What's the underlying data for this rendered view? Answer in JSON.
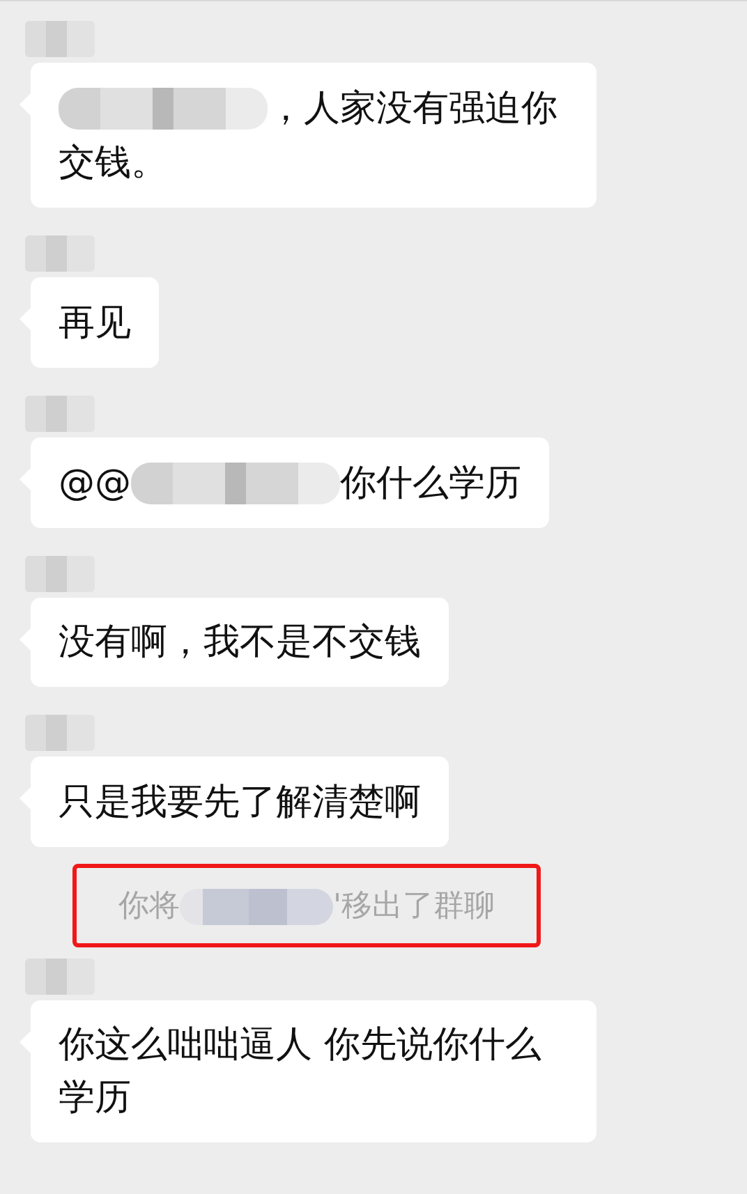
{
  "messages": [
    {
      "kind": "message",
      "sender_redacted": true,
      "parts": [
        {
          "kind": "redacted"
        },
        {
          "kind": "text",
          "text": "，人家没有强迫你"
        },
        {
          "kind": "text",
          "text": "交钱。"
        }
      ]
    },
    {
      "kind": "message",
      "sender_redacted": true,
      "parts": [
        {
          "kind": "text",
          "text": "再见"
        }
      ]
    },
    {
      "kind": "message",
      "sender_redacted": true,
      "parts": [
        {
          "kind": "text",
          "text": "@@"
        },
        {
          "kind": "redacted"
        },
        {
          "kind": "text",
          "text": "你什么学历"
        }
      ]
    },
    {
      "kind": "message",
      "sender_redacted": true,
      "parts": [
        {
          "kind": "text",
          "text": "没有啊，我不是不交钱"
        }
      ]
    },
    {
      "kind": "message",
      "sender_redacted": true,
      "parts": [
        {
          "kind": "text",
          "text": "只是我要先了解清楚啊"
        }
      ]
    },
    {
      "kind": "system",
      "highlighted": true,
      "parts": [
        {
          "kind": "text",
          "text": "你将"
        },
        {
          "kind": "redacted"
        },
        {
          "kind": "text",
          "text": "'移出了群聊"
        }
      ]
    },
    {
      "kind": "message",
      "sender_redacted": true,
      "parts": [
        {
          "kind": "text",
          "text": "你这么咄咄逼人 你先说你什么学历"
        }
      ]
    }
  ]
}
